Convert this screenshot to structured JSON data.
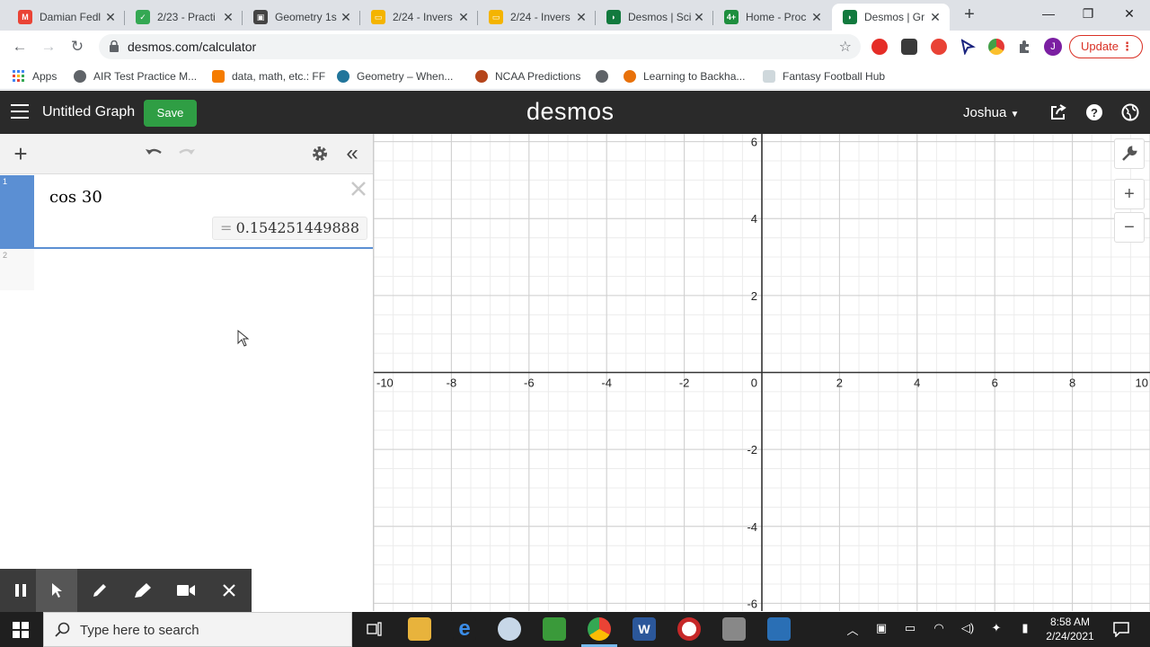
{
  "browser": {
    "tabs": [
      {
        "title": "Damian Fedl",
        "color": "#ea4335",
        "glyph": "M"
      },
      {
        "title": "2/23 - Practi",
        "color": "#34a853",
        "glyph": "✓"
      },
      {
        "title": "Geometry 1s",
        "color": "#444444",
        "glyph": "▣"
      },
      {
        "title": "2/24 - Invers",
        "color": "#f4b400",
        "glyph": "▭"
      },
      {
        "title": "2/24 - Invers",
        "color": "#f4b400",
        "glyph": "▭"
      },
      {
        "title": "Desmos | Sci",
        "color": "#127a3e",
        "glyph": "◗"
      },
      {
        "title": "Home - Proc",
        "color": "#1e8e3e",
        "glyph": "4+"
      },
      {
        "title": "Desmos | Gr",
        "color": "#127a3e",
        "glyph": "◗"
      }
    ],
    "active_tab_index": 7,
    "url": "desmos.com/calculator",
    "update_label": "Update",
    "profile_initial": "J"
  },
  "bookmarks": [
    {
      "label": "Apps",
      "color": "#4285f4"
    },
    {
      "label": "AIR Test Practice M...",
      "color": "#5f6368"
    },
    {
      "label": "data, math, etc.: FF",
      "color": "#f57c00"
    },
    {
      "label": "Geometry – When...",
      "color": "#21759b"
    },
    {
      "label": "NCAA Predictions",
      "color": "#b5451b"
    },
    {
      "label": "",
      "color": "#5f6368"
    },
    {
      "label": "Learning to Backha...",
      "color": "#e8710a"
    },
    {
      "label": "Fantasy Football Hub",
      "color": "#9aa0a6"
    }
  ],
  "desmos": {
    "graph_title": "Untitled Graph",
    "save_label": "Save",
    "logo": "desmos",
    "user": "Joshua",
    "expressions": [
      {
        "index": "1",
        "latex": "cos 30",
        "result": "0.154251449888"
      },
      {
        "index": "2",
        "latex": "",
        "result": ""
      }
    ],
    "equals_sign": "="
  },
  "graph": {
    "x_ticks": [
      "-10",
      "-8",
      "-6",
      "-4",
      "-2",
      "0",
      "2",
      "4",
      "6",
      "8",
      "10"
    ],
    "y_ticks": [
      "6",
      "4",
      "2",
      "-2",
      "-4",
      "-6"
    ],
    "xlim": [
      -10,
      10
    ],
    "ylim": [
      -6.2,
      6.2
    ],
    "grid": true
  },
  "taskbar": {
    "search_placeholder": "Type here to search",
    "time": "8:58 AM",
    "date": "2/24/2021"
  }
}
